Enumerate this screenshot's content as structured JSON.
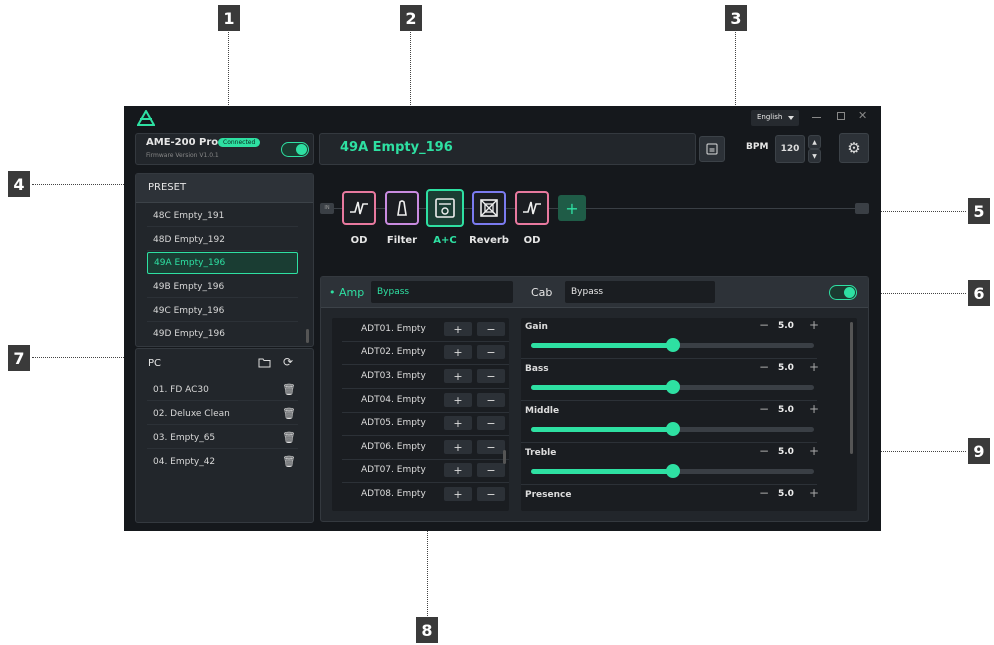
{
  "callouts": [
    "1",
    "2",
    "3",
    "4",
    "5",
    "6",
    "7",
    "8",
    "9"
  ],
  "colors": {
    "accent": "#2ee0a2",
    "background": "#15181c",
    "panel": "#22262b"
  },
  "titlebar": {
    "language": "English",
    "language_icon": "chevron-down-icon"
  },
  "device": {
    "name": "AME-200 Pro",
    "status": "Connected",
    "firmware": "Firmware Version V1.0.1",
    "power_on": true
  },
  "preset_header": {
    "title": "49A Empty_196"
  },
  "bpm": {
    "label": "BPM",
    "value": "120"
  },
  "preset_list": {
    "title": "PRESET",
    "items": [
      {
        "label": "48C Empty_191"
      },
      {
        "label": "48D Empty_192"
      },
      {
        "label": "49A Empty_196",
        "selected": true
      },
      {
        "label": "49B Empty_196"
      },
      {
        "label": "49C Empty_196"
      },
      {
        "label": "49D Empty_196"
      }
    ]
  },
  "pc_list": {
    "title": "PC",
    "items": [
      {
        "label": "01. FD AC30"
      },
      {
        "label": "02. Deluxe Clean"
      },
      {
        "label": "03. Empty_65"
      },
      {
        "label": "04. Empty_42"
      }
    ]
  },
  "chain": {
    "in_label": "IN",
    "modules": [
      {
        "label": "OD",
        "color": "#e8799f"
      },
      {
        "label": "Filter",
        "color": "#c98be0"
      },
      {
        "label": "A+C",
        "color": "#2ee0a2",
        "selected": true
      },
      {
        "label": "Reverb",
        "color": "#7b7bf0"
      },
      {
        "label": "OD",
        "color": "#e8799f"
      }
    ],
    "add_label": "+"
  },
  "module_panel": {
    "amp_label": "Amp",
    "amp_value": "Bypass",
    "cab_label": "Cab",
    "cab_value": "Bypass",
    "enabled": true
  },
  "adt_list": {
    "plus": "+",
    "minus": "−",
    "items": [
      {
        "label": "ADT01. Empty"
      },
      {
        "label": "ADT02. Empty"
      },
      {
        "label": "ADT03. Empty"
      },
      {
        "label": "ADT04. Empty"
      },
      {
        "label": "ADT05. Empty"
      },
      {
        "label": "ADT06. Empty"
      },
      {
        "label": "ADT07. Empty"
      },
      {
        "label": "ADT08. Empty"
      }
    ]
  },
  "params": {
    "minus": "−",
    "plus": "+",
    "items": [
      {
        "label": "Gain",
        "value": "5.0",
        "level": 0.5
      },
      {
        "label": "Bass",
        "value": "5.0",
        "level": 0.5
      },
      {
        "label": "Middle",
        "value": "5.0",
        "level": 0.5
      },
      {
        "label": "Treble",
        "value": "5.0",
        "level": 0.5
      },
      {
        "label": "Presence",
        "value": "5.0",
        "level": 0.5
      }
    ]
  }
}
